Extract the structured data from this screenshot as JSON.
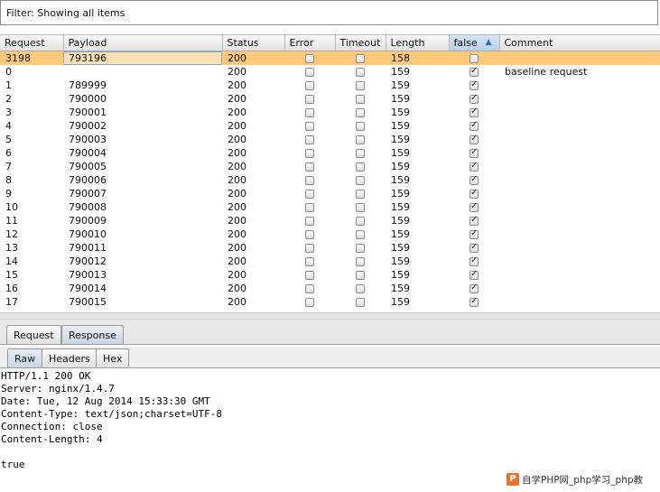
{
  "filter": {
    "text": "Filter: Showing all items"
  },
  "table": {
    "columns": [
      "Request",
      "Payload",
      "Status",
      "Error",
      "Timeout",
      "Length",
      "false",
      "Comment"
    ],
    "sort_indicator": "▲",
    "rows": [
      {
        "request": "3198",
        "payload": "793196",
        "status": "200",
        "error": false,
        "timeout": false,
        "length": "158",
        "flag": false,
        "comment": "",
        "selected": true
      },
      {
        "request": "0",
        "payload": "",
        "status": "200",
        "error": false,
        "timeout": false,
        "length": "159",
        "flag": true,
        "comment": "baseline request",
        "selected": false
      },
      {
        "request": "1",
        "payload": "789999",
        "status": "200",
        "error": false,
        "timeout": false,
        "length": "159",
        "flag": true,
        "comment": "",
        "selected": false
      },
      {
        "request": "2",
        "payload": "790000",
        "status": "200",
        "error": false,
        "timeout": false,
        "length": "159",
        "flag": true,
        "comment": "",
        "selected": false
      },
      {
        "request": "3",
        "payload": "790001",
        "status": "200",
        "error": false,
        "timeout": false,
        "length": "159",
        "flag": true,
        "comment": "",
        "selected": false
      },
      {
        "request": "4",
        "payload": "790002",
        "status": "200",
        "error": false,
        "timeout": false,
        "length": "159",
        "flag": true,
        "comment": "",
        "selected": false
      },
      {
        "request": "5",
        "payload": "790003",
        "status": "200",
        "error": false,
        "timeout": false,
        "length": "159",
        "flag": true,
        "comment": "",
        "selected": false
      },
      {
        "request": "6",
        "payload": "790004",
        "status": "200",
        "error": false,
        "timeout": false,
        "length": "159",
        "flag": true,
        "comment": "",
        "selected": false
      },
      {
        "request": "7",
        "payload": "790005",
        "status": "200",
        "error": false,
        "timeout": false,
        "length": "159",
        "flag": true,
        "comment": "",
        "selected": false
      },
      {
        "request": "8",
        "payload": "790006",
        "status": "200",
        "error": false,
        "timeout": false,
        "length": "159",
        "flag": true,
        "comment": "",
        "selected": false
      },
      {
        "request": "9",
        "payload": "790007",
        "status": "200",
        "error": false,
        "timeout": false,
        "length": "159",
        "flag": true,
        "comment": "",
        "selected": false
      },
      {
        "request": "10",
        "payload": "790008",
        "status": "200",
        "error": false,
        "timeout": false,
        "length": "159",
        "flag": true,
        "comment": "",
        "selected": false
      },
      {
        "request": "11",
        "payload": "790009",
        "status": "200",
        "error": false,
        "timeout": false,
        "length": "159",
        "flag": true,
        "comment": "",
        "selected": false
      },
      {
        "request": "12",
        "payload": "790010",
        "status": "200",
        "error": false,
        "timeout": false,
        "length": "159",
        "flag": true,
        "comment": "",
        "selected": false
      },
      {
        "request": "13",
        "payload": "790011",
        "status": "200",
        "error": false,
        "timeout": false,
        "length": "159",
        "flag": true,
        "comment": "",
        "selected": false
      },
      {
        "request": "14",
        "payload": "790012",
        "status": "200",
        "error": false,
        "timeout": false,
        "length": "159",
        "flag": true,
        "comment": "",
        "selected": false
      },
      {
        "request": "15",
        "payload": "790013",
        "status": "200",
        "error": false,
        "timeout": false,
        "length": "159",
        "flag": true,
        "comment": "",
        "selected": false
      },
      {
        "request": "16",
        "payload": "790014",
        "status": "200",
        "error": false,
        "timeout": false,
        "length": "159",
        "flag": true,
        "comment": "",
        "selected": false
      },
      {
        "request": "17",
        "payload": "790015",
        "status": "200",
        "error": false,
        "timeout": false,
        "length": "159",
        "flag": true,
        "comment": "",
        "selected": false
      }
    ]
  },
  "outer_tabs": [
    "Request",
    "Response"
  ],
  "inner_tabs": [
    "Raw",
    "Headers",
    "Hex"
  ],
  "response_lines": [
    "HTTP/1.1 200 OK",
    "Server: nginx/1.4.7",
    "Date: Tue, 12 Aug 2014 15:33:30 GMT",
    "Content-Type: text/json;charset=UTF-8",
    "Connection: close",
    "Content-Length: 4",
    "",
    "true"
  ],
  "watermark": {
    "logo": "P",
    "text": "自学PHP网_php学习_php教"
  }
}
